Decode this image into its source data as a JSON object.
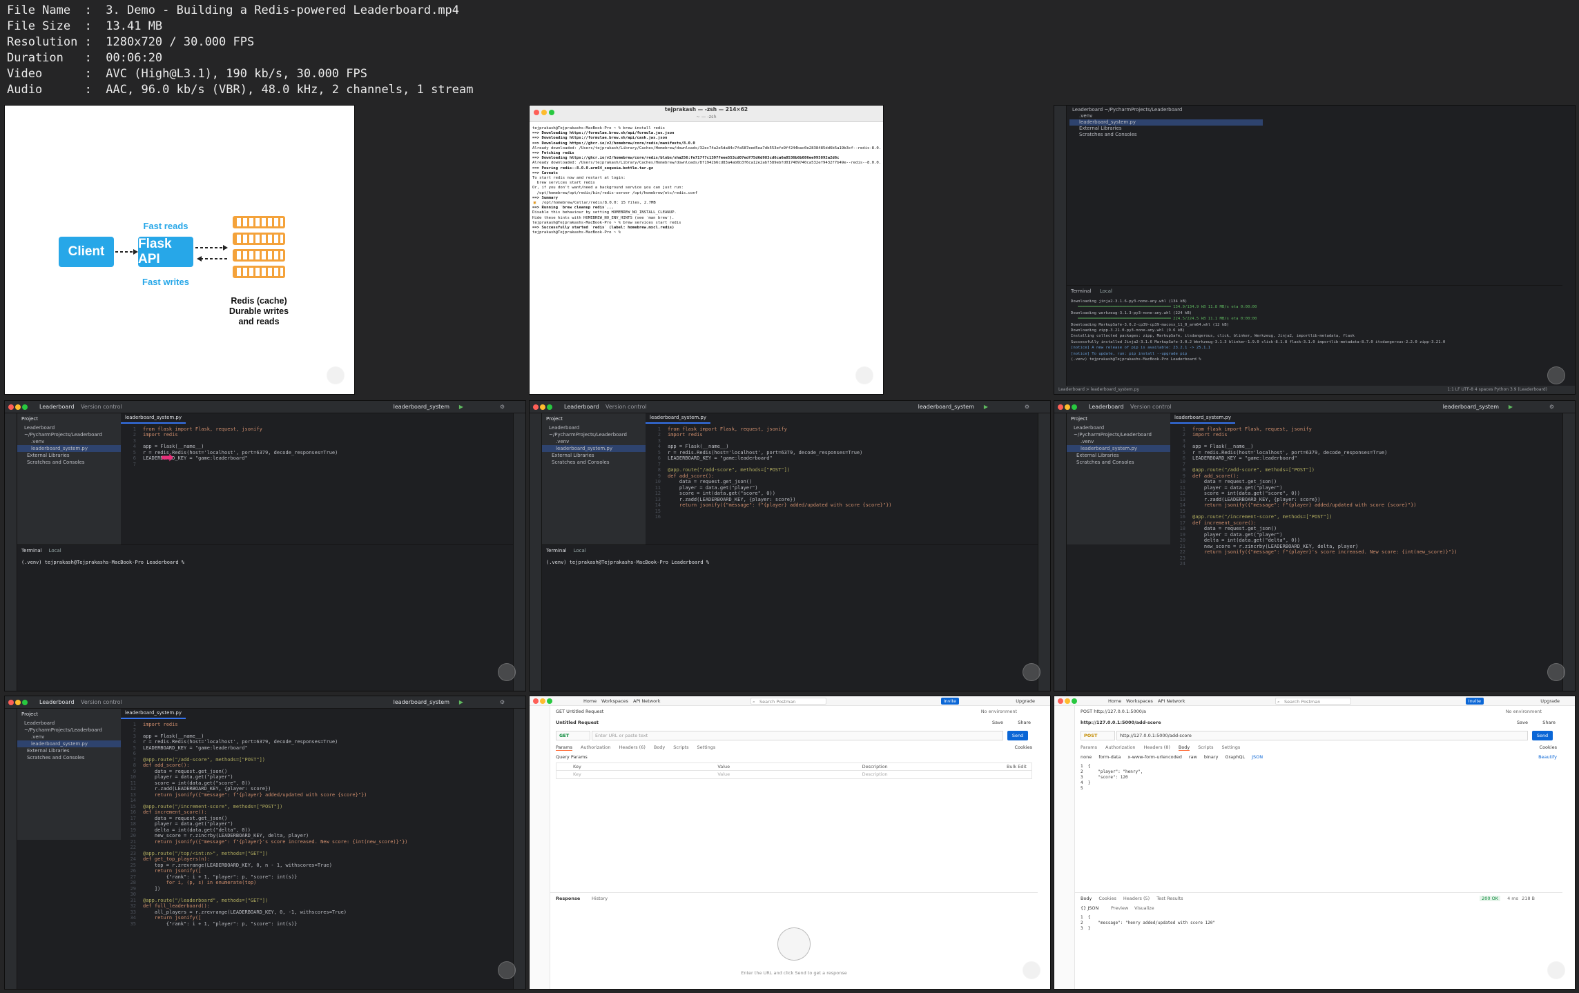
{
  "info": {
    "lines": [
      "File Name  :  3. Demo - Building a Redis-powered Leaderboard.mp4",
      "File Size  :  13.41 MB",
      "Resolution :  1280x720 / 30.000 FPS",
      "Duration   :  00:06:20",
      "Video      :  AVC (High@L3.1), 190 kb/s, 30.000 FPS",
      "Audio      :  AAC, 96.0 kb/s (VBR), 48.0 kHz, 2 channels, 1 stream"
    ]
  },
  "diagram": {
    "client": "Client",
    "api": "Flask API",
    "fast_reads": "Fast reads",
    "fast_writes": "Fast writes",
    "redis": "Redis (cache)",
    "durable": "Durable writes",
    "and_reads": "and reads"
  },
  "terminal": {
    "title": "tejprakash — -zsh — 214×62",
    "subtitle": "~ — -zsh",
    "lines": [
      "tejprakash@Tejprakashs-MacBook-Pro ~ % brew install redis",
      "==> Downloading https://formulae.brew.sh/api/formula.jws.json",
      "==> Downloading https://formulae.brew.sh/api/cask.jws.json",
      "==> Downloading https://ghcr.io/v2/homebrew/core/redis/manifests/8.0.0",
      "Already downloaded: /Users/tejprakash/Library/Caches/Homebrew/downloads/32ec74a2e5da84c7fa587eed5ea7db553efe9ff244bac0e2838485dd6b5a19b3cf--redis-8.0.0.bottle_manifest.json",
      "==> Fetching redis",
      "==> Downloading https://ghcr.io/v2/homebrew/core/redis/blobs/sha256:fe717f7c1397feee553cd07edf75d6d983cd6ca6a8536b6b086ee995892a2d6c",
      "Already downloaded: /Users/tejprakash/Library/Caches/Homebrew/downloads/8f1942b6cd83a4ab6b3f6ca12e2ab7589ebfd017409740ca532ef9432f7b49e--redis--8.0.0.arm64_sequoia.bottle.tar.gz",
      "==> Pouring redis--8.0.0.arm64_sequoia.bottle.tar.gz",
      "==> Caveats",
      "To start redis now and restart at login:",
      "  brew services start redis",
      "Or, if you don't want/need a background service you can just run:",
      "  /opt/homebrew/opt/redis/bin/redis-server /opt/homebrew/etc/redis.conf",
      "==> Summary",
      "🍺  /opt/homebrew/Cellar/redis/8.0.0: 15 files, 2.7MB",
      "==> Running `brew cleanup redis`...",
      "Disable this behaviour by setting HOMEBREW_NO_INSTALL_CLEANUP.",
      "Hide these hints with HOMEBREW_NO_ENV_HINTS (see `man brew`).",
      "tejprakash@Tejprakashs-MacBook-Pro ~ % brew services start redis",
      "==> Successfully started `redis` (label: homebrew.mxcl.redis)",
      "tejprakash@Tejprakashs-MacBook-Pro ~ % "
    ]
  },
  "pip": {
    "tree": [
      "Leaderboard ~/PycharmProjects/Leaderboard",
      ".venv",
      "leaderboard_system.py",
      "External Libraries",
      "Scratches and Consoles"
    ],
    "tab_terminal": "Terminal",
    "tab_local": "Local",
    "lines": [
      "Downloading jinja2-3.1.6-py3-none-any.whl (134 kB)",
      "   ━━━━━━━━━━━━━━━━━━━━━━━━━━━━━━━━━━━━━━━━ 134.9/134.9 kB 11.8 MB/s eta 0:00:00",
      "Downloading werkzeug-3.1.3-py3-none-any.whl (224 kB)",
      "   ━━━━━━━━━━━━━━━━━━━━━━━━━━━━━━━━━━━━━━━━ 224.5/224.5 kB 11.1 MB/s eta 0:00:00",
      "Downloading MarkupSafe-3.0.2-cp39-cp39-macosx_11_0_arm64.whl (12 kB)",
      "Downloading zipp-3.21.0-py3-none-any.whl (9.6 kB)",
      "Installing collected packages: zipp, MarkupSafe, itsdangerous, click, blinker, Werkzeug, Jinja2, importlib-metadata, flask",
      "Successfully installed Jinja2-3.1.6 MarkupSafe-3.0.2 Werkzeug-3.1.3 blinker-1.9.0 click-8.1.8 flask-3.1.0 importlib-metadata-8.7.0 itsdangerous-2.2.0 zipp-3.21.0",
      "",
      "[notice] A new release of pip is available: 23.2.1 -> 25.1.1",
      "[notice] To update, run: pip install --upgrade pip",
      "(.venv) tejprakash@Tejprakashs-MacBook-Pro Leaderboard % "
    ],
    "status": "Leaderboard > leaderboard_system.py",
    "status_right": "1:1  LF  UTF-8  4 spaces  Python 3.9 (Leaderboard)"
  },
  "ide": {
    "project": "Leaderboard",
    "vcs": "Version control",
    "run_config": "leaderboard_system",
    "tab_project": "Project",
    "file_tab": "leaderboard_system.py",
    "tree": [
      "Leaderboard ~/PycharmProjects/Leaderboard",
      ".venv",
      "leaderboard_system.py",
      "External Libraries",
      "Scratches and Consoles"
    ],
    "tab_terminal": "Terminal",
    "tab_local": "Local",
    "prompt": "(.venv) tejprakash@Tejprakashs-MacBook-Pro Leaderboard % "
  },
  "code1": [
    "from flask import Flask, request, jsonify",
    "import redis",
    "",
    "app = Flask(__name__)",
    "r = redis.Redis(host='localhost', port=6379, decode_responses=True)",
    "LEADERBOARD_KEY = \"game:leaderboard\"",
    ""
  ],
  "code2": [
    "from flask import Flask, request, jsonify",
    "import redis",
    "",
    "app = Flask(__name__)",
    "r = redis.Redis(host='localhost', port=6379, decode_responses=True)",
    "LEADERBOARD_KEY = \"game:leaderboard\"",
    "",
    "@app.route(\"/add-score\", methods=[\"POST\"])",
    "def add_score():",
    "    data = request.get_json()",
    "    player = data.get(\"player\")",
    "    score = int(data.get(\"score\", 0))",
    "    r.zadd(LEADERBOARD_KEY, {player: score})",
    "    return jsonify({\"message\": f\"{player} added/updated with score {score}\"})",
    "",
    ""
  ],
  "code3": [
    "from flask import Flask, request, jsonify",
    "import redis",
    "",
    "app = Flask(__name__)",
    "r = redis.Redis(host='localhost', port=6379, decode_responses=True)",
    "LEADERBOARD_KEY = \"game:leaderboard\"",
    "",
    "@app.route(\"/add-score\", methods=[\"POST\"])",
    "def add_score():",
    "    data = request.get_json()",
    "    player = data.get(\"player\")",
    "    score = int(data.get(\"score\", 0))",
    "    r.zadd(LEADERBOARD_KEY, {player: score})",
    "    return jsonify({\"message\": f\"{player} added/updated with score {score}\"})",
    "",
    "@app.route(\"/increment-score\", methods=[\"POST\"])",
    "def increment_score():",
    "    data = request.get_json()",
    "    player = data.get(\"player\")",
    "    delta = int(data.get(\"delta\", 0))",
    "    new_score = r.zincrby(LEADERBOARD_KEY, delta, player)",
    "    return jsonify({\"message\": f\"{player}'s score increased. New score: {int(new_score)}\"})",
    "",
    ""
  ],
  "code4": [
    "import redis",
    "",
    "app = Flask(__name__)",
    "r = redis.Redis(host='localhost', port=6379, decode_responses=True)",
    "LEADERBOARD_KEY = \"game:leaderboard\"",
    "",
    "@app.route(\"/add-score\", methods=[\"POST\"])",
    "def add_score():",
    "    data = request.get_json()",
    "    player = data.get(\"player\")",
    "    score = int(data.get(\"score\", 0))",
    "    r.zadd(LEADERBOARD_KEY, {player: score})",
    "    return jsonify({\"message\": f\"{player} added/updated with score {score}\"})",
    "",
    "@app.route(\"/increment-score\", methods=[\"POST\"])",
    "def increment_score():",
    "    data = request.get_json()",
    "    player = data.get(\"player\")",
    "    delta = int(data.get(\"delta\", 0))",
    "    new_score = r.zincrby(LEADERBOARD_KEY, delta, player)",
    "    return jsonify({\"message\": f\"{player}'s score increased. New score: {int(new_score)}\"})",
    "",
    "@app.route(\"/top/<int:n>\", methods=[\"GET\"])",
    "def get_top_players(n):",
    "    top = r.zrevrange(LEADERBOARD_KEY, 0, n - 1, withscores=True)",
    "    return jsonify([",
    "        {\"rank\": i + 1, \"player\": p, \"score\": int(s)}",
    "        for i, (p, s) in enumerate(top)",
    "    ])",
    "",
    "@app.route(\"/leaderboard\", methods=[\"GET\"])",
    "def full_leaderboard():",
    "    all_players = r.zrevrange(LEADERBOARD_KEY, 0, -1, withscores=True)",
    "    return jsonify([",
    "        {\"rank\": i + 1, \"player\": p, \"score\": int(s)}"
  ],
  "pm1": {
    "home": "Home",
    "workspaces": "Workspaces",
    "api_network": "API Network",
    "search": "Search Postman",
    "invite": "Invite",
    "upgrade": "Upgrade",
    "tab": "GET Untitled Request",
    "env": "No environment",
    "title": "Untitled Request",
    "save": "Save",
    "share": "Share",
    "method": "GET",
    "url_placeholder": "Enter URL or paste text",
    "send": "Send",
    "tabs": [
      "Params",
      "Authorization",
      "Headers (6)",
      "Body",
      "Scripts",
      "Settings"
    ],
    "cookies": "Cookies",
    "query_params": "Query Params",
    "cols": [
      "Key",
      "Value",
      "Description",
      "Bulk Edit"
    ],
    "row": [
      "Key",
      "Value",
      "Description"
    ],
    "response": "Response",
    "history": "History",
    "hint": "Enter the URL and click Send to get a response"
  },
  "pm2": {
    "home": "Home",
    "workspaces": "Workspaces",
    "api_network": "API Network",
    "search": "Search Postman",
    "invite": "Invite",
    "upgrade": "Upgrade",
    "tab": "POST http://127.0.0.1:5000/a",
    "env": "No environment",
    "title": "http://127.0.0.1:5000/add-score",
    "save": "Save",
    "share": "Share",
    "method": "POST",
    "url": "http://127.0.0.1:5000/add-score",
    "send": "Send",
    "tabs": [
      "Params",
      "Authorization",
      "Headers (8)",
      "Body",
      "Scripts",
      "Settings"
    ],
    "cookies": "Cookies",
    "body_types": [
      "none",
      "form-data",
      "x-www-form-urlencoded",
      "raw",
      "binary",
      "GraphQL",
      "JSON"
    ],
    "beautify": "Beautify",
    "body_lines": [
      "1  {",
      "2      \"player\": \"henry\",",
      "3      \"score\": 120",
      "4  }",
      "5"
    ],
    "resp_tabs": [
      "Body",
      "Cookies",
      "Headers (5)",
      "Test Results"
    ],
    "status": "200 OK",
    "time": "4 ms",
    "size": "218 B",
    "resp_format": "{} JSON",
    "preview": "Preview",
    "visualize": "Visualize",
    "resp_lines": [
      "1  {",
      "2      \"message\": \"henry added/updated with score 120\"",
      "3  }"
    ]
  }
}
